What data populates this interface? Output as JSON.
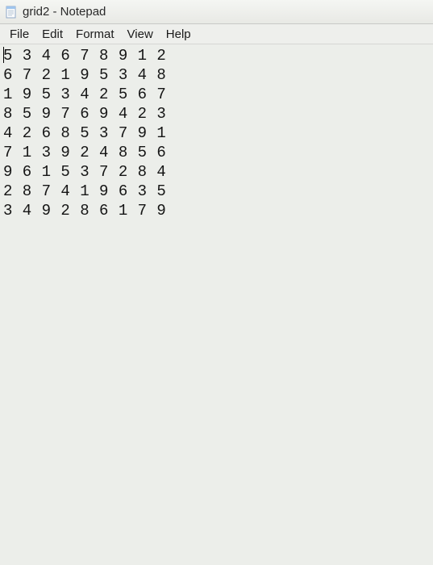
{
  "titlebar": {
    "title": "grid2 - Notepad"
  },
  "menubar": {
    "items": [
      "File",
      "Edit",
      "Format",
      "View",
      "Help"
    ]
  },
  "editor": {
    "content": "5 3 4 6 7 8 9 1 2\n6 7 2 1 9 5 3 4 8\n1 9 5 3 4 2 5 6 7\n8 5 9 7 6 9 4 2 3\n4 2 6 8 5 3 7 9 1\n7 1 3 9 2 4 8 5 6\n9 6 1 5 3 7 2 8 4\n2 8 7 4 1 9 6 3 5\n3 4 9 2 8 6 1 7 9"
  }
}
